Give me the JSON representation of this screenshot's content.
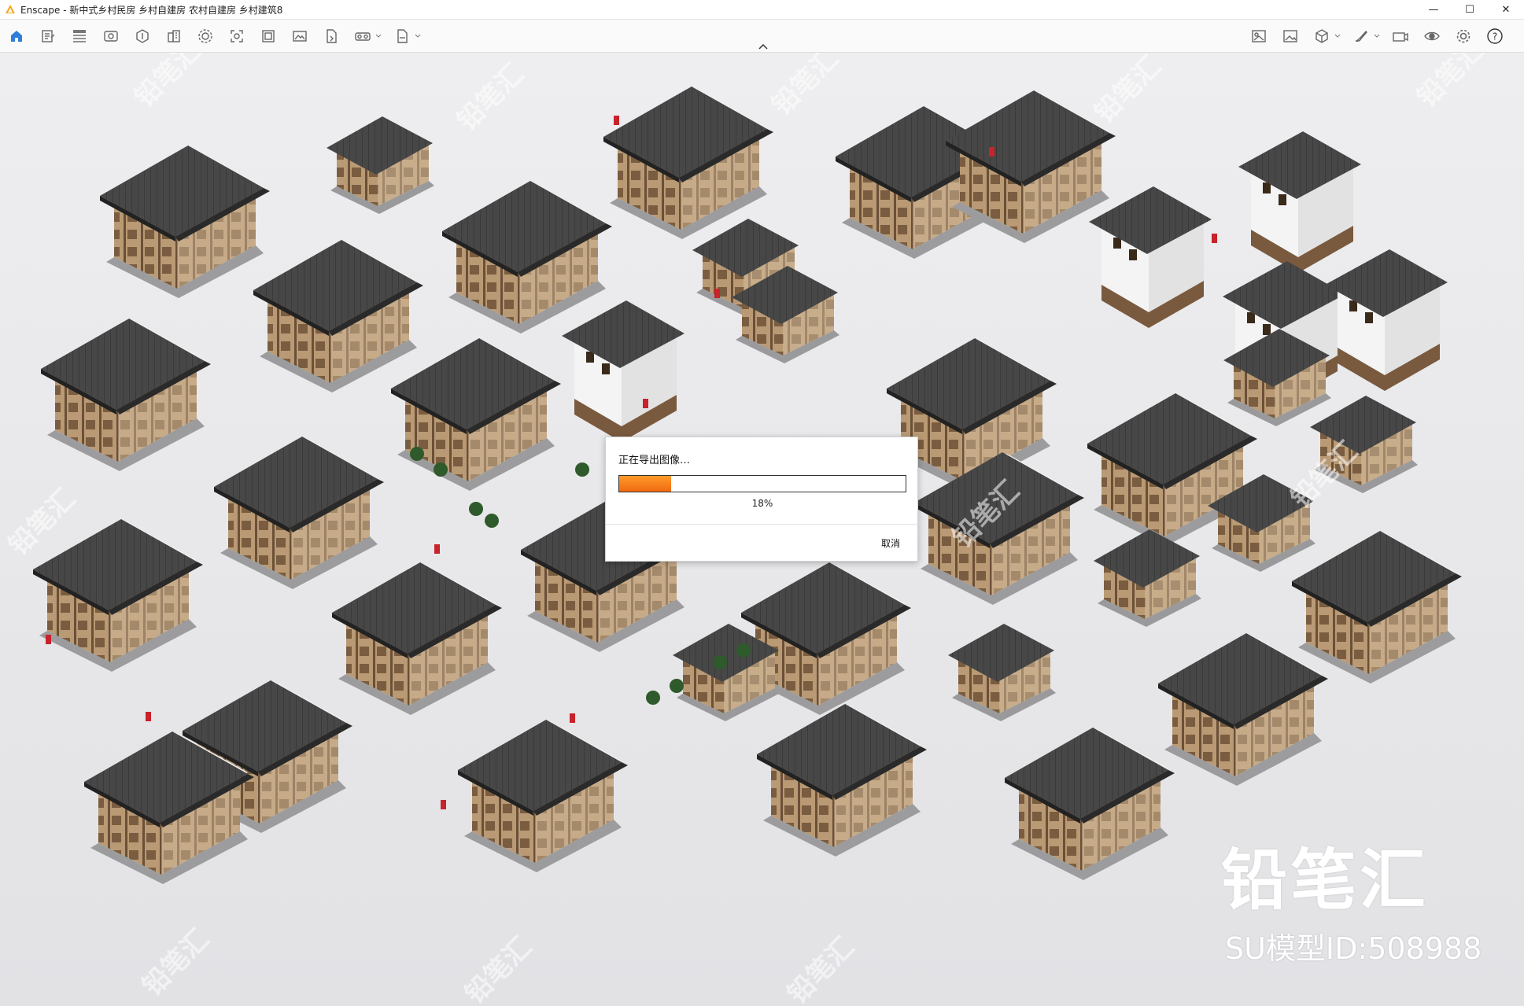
{
  "window": {
    "title": "Enscape - 新中式乡村民房 乡村自建房 农村自建房 乡村建筑8",
    "minimize_label": "—",
    "maximize_label": "☐",
    "close_label": "✕"
  },
  "toolbar": {
    "left_icons": [
      "home-icon",
      "notes-icon",
      "bim-icon",
      "view-icon",
      "asset-library-icon",
      "building-icon",
      "settings-gear-icon",
      "screenshot-icon",
      "frame-icon",
      "image-icon",
      "file-export-icon",
      "vr-headset-icon",
      "exe-export-icon"
    ],
    "right_icons": [
      "image-editor-icon",
      "gallery-icon",
      "cube-icon",
      "brush-icon",
      "camera-icon",
      "eye-icon",
      "settings-icon",
      "help-icon"
    ]
  },
  "dialog": {
    "title": "正在导出图像…",
    "progress_value": 0.18,
    "progress_text": "18%",
    "cancel_label": "取消",
    "accent_color": "#f47b18"
  },
  "watermark": {
    "brand": "铅笔汇",
    "model_id": "SU模型ID:508988",
    "tile_text": "铅笔汇"
  }
}
